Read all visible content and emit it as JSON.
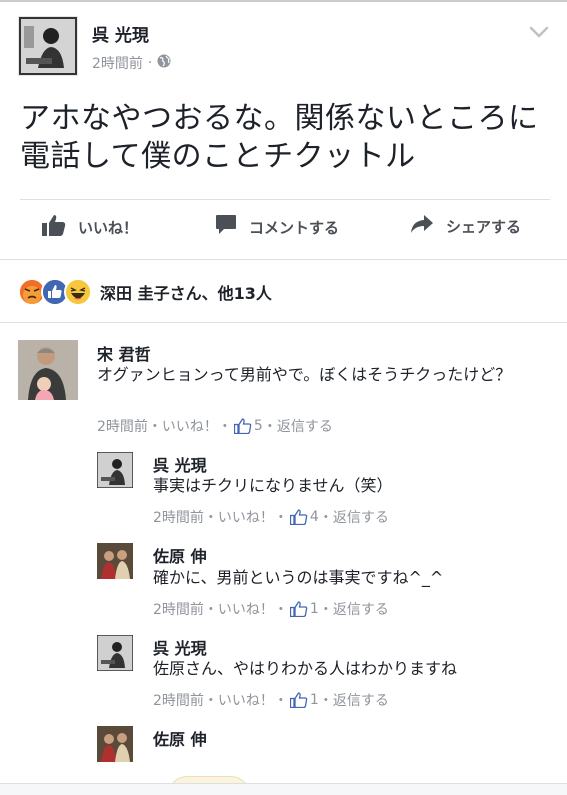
{
  "post": {
    "author": "呉 光現",
    "time": "2時間前",
    "visibility_icon": "globe-icon",
    "text": "アホなやつおるな。関係ないところに電話して僕のことチクットル"
  },
  "actions": {
    "like": "いいね！",
    "comment": "コメントする",
    "share": "シェアする"
  },
  "reactions": {
    "summary": "深田 圭子さん、他13人",
    "icons": [
      "angry-icon",
      "like-icon",
      "haha-icon"
    ]
  },
  "comments": [
    {
      "name": "宋 君哲",
      "text": "オグァンヒョンって男前やで。ぼくはそうチクったけど？",
      "time": "2時間前",
      "like": "いいね！",
      "count": "5",
      "reply": "返信する"
    },
    {
      "name": "呉 光現",
      "text": "事実はチクリになりません（笑）",
      "time": "2時間前",
      "like": "いいね！",
      "count": "4",
      "reply": "返信する"
    },
    {
      "name": "佐原 伸",
      "text": "確かに、男前というのは事実ですね^_^",
      "time": "2時間前",
      "like": "いいね！",
      "count": "1",
      "reply": "返信する"
    },
    {
      "name": "呉 光現",
      "text": "佐原さん、やはりわかる人はわかりますね",
      "time": "2時間前",
      "like": "いいね！",
      "count": "1",
      "reply": "返信する"
    },
    {
      "name": "佐原 伸",
      "text": "",
      "time": "",
      "like": "",
      "count": "",
      "reply": ""
    }
  ],
  "colors": {
    "brand_blue": "#4267b2",
    "angry": "#f0702a",
    "haha": "#f7c73d",
    "meta_gray": "#90949c"
  }
}
